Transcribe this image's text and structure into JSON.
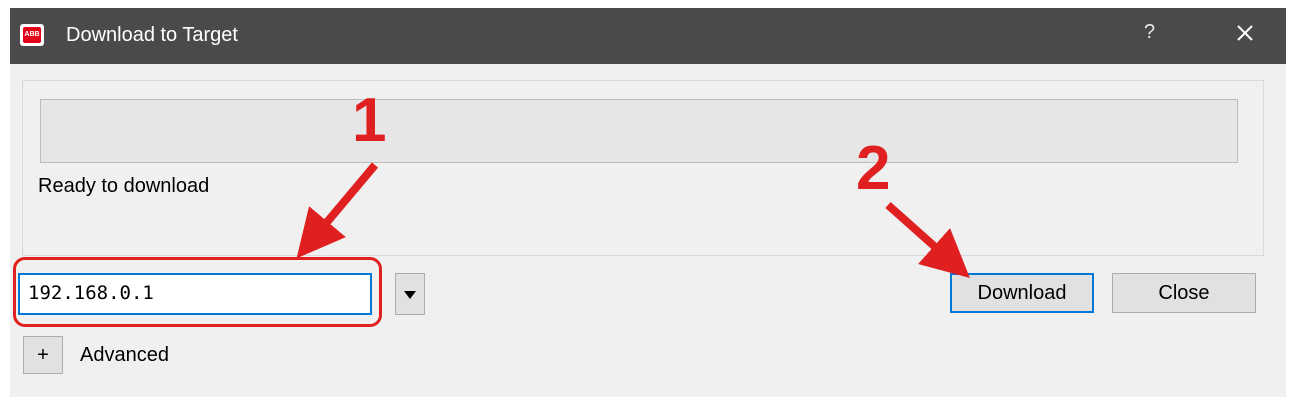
{
  "window": {
    "title": "Download to Target",
    "icon": "abb-logo-icon",
    "help_label": "?",
    "app_icon_text": "ABB"
  },
  "progress": {
    "value": 0,
    "status_text": "Ready to download"
  },
  "target": {
    "ip_value": "192.168.0.1"
  },
  "buttons": {
    "download_label": "Download",
    "close_label": "Close",
    "expand_label": "+",
    "advanced_label": "Advanced"
  },
  "annotations": {
    "step1": "1",
    "step2": "2",
    "color": "#e02020"
  },
  "colors": {
    "titlebar": "#4a4a4a",
    "focus": "#0078d7"
  }
}
